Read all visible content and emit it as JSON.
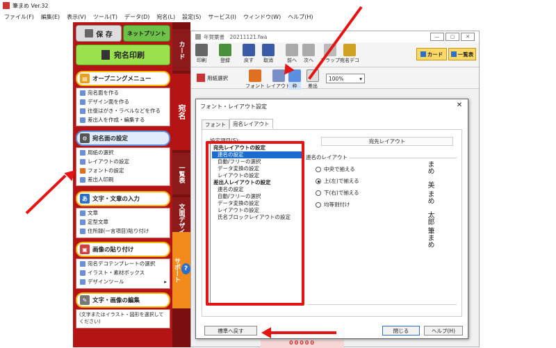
{
  "app": {
    "title": "筆まめ Ver.32"
  },
  "menu": [
    "ファイル(F)",
    "編集(E)",
    "表示(V)",
    "ツール(T)",
    "データ(D)",
    "宛名(L)",
    "設定(S)",
    "サービス(I)",
    "ウィンドウ(W)",
    "ヘルプ(H)"
  ],
  "sidebar": {
    "save_label": "保 存",
    "netprint_label": "ネットプリント",
    "print_label": "宛名印刷",
    "sections": [
      {
        "title": "オープニングメニュー",
        "items": [
          "宛名面を作る",
          "デザイン面を作る",
          "往復はがき・ラベルなどを作る",
          "差出人を作成・編集する"
        ]
      },
      {
        "title": "宛名面の設定",
        "items": [
          "用紙の選択",
          "レイアウトの設定",
          "フォントの設定",
          "差出人印刷"
        ]
      },
      {
        "title": "文字・文章の入力",
        "items": [
          "文章",
          "定型文章",
          "住所録(一言項目)貼り付け"
        ]
      },
      {
        "title": "画像の貼り付け",
        "items": [
          "宛名デコテンプレートの選択",
          "イラスト・素材ボックス",
          "デザインツール"
        ]
      },
      {
        "title": "文字・画像の編集",
        "items": [
          "(文字またはイラスト・図形を選択してください)"
        ]
      }
    ]
  },
  "tabs": [
    "カード",
    "宛名",
    "一覧表",
    "文面デザイン",
    "サポート"
  ],
  "doc": {
    "title": "年賀葉書　20211121.fwa"
  },
  "toolbar1": [
    "印刷",
    "登録",
    "戻す",
    "取消",
    "前へ",
    "次へ",
    "フラップ",
    "宛名デコ"
  ],
  "toolbar1_right": [
    "カード",
    "一覧表"
  ],
  "toolbar2": {
    "paper": "用紙選択",
    "buttons": [
      "フォント",
      "レイアウト",
      "枠",
      "差出"
    ],
    "zoom": "100%"
  },
  "dialog": {
    "title": "フォント・レイアウト設定",
    "tabs": [
      "フォント",
      "宛名レイアウト"
    ],
    "list_label": "設定項目(S):",
    "list": [
      {
        "t": "宛先レイアウトの設定",
        "h": true
      },
      {
        "t": "連名の設定",
        "sel": true
      },
      {
        "t": "自動/フリーの選択"
      },
      {
        "t": "データ変換の設定"
      },
      {
        "t": "レイアウトの設定"
      },
      {
        "t": "差出人レイアウトの設定",
        "h": true
      },
      {
        "t": "連名の設定"
      },
      {
        "t": "自動/フリーの選択"
      },
      {
        "t": "データ変換の設定"
      },
      {
        "t": "レイアウトの設定"
      },
      {
        "t": "氏名ブロックレイアウトの設定"
      }
    ],
    "panel_header": "宛先レイアウト",
    "group_label": "連名のレイアウト",
    "radios": [
      {
        "label": "中央で揃える",
        "on": false
      },
      {
        "label": "上(左)で揃える",
        "on": true
      },
      {
        "label": "下(右)で揃える",
        "on": false
      },
      {
        "label": "均等割付け",
        "on": false
      }
    ],
    "preview_text": [
      "筆まめ",
      "まめ　太郎",
      "まめ　美"
    ],
    "reset_label": "標準へ戻す",
    "close_label": "閉じる",
    "help_label": "ヘルプ(H)"
  },
  "footer_text": "00000"
}
